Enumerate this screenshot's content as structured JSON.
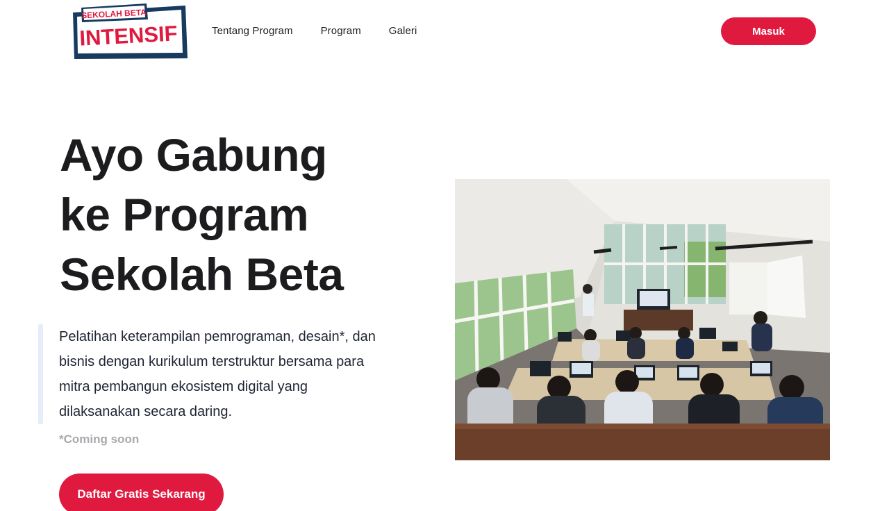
{
  "header": {
    "logo": {
      "top_text": "SEKOLAH BETA",
      "main_text": "INTENSIF"
    },
    "nav": [
      {
        "label": "Tentang Program"
      },
      {
        "label": "Program"
      },
      {
        "label": "Galeri"
      }
    ],
    "login_label": "Masuk"
  },
  "hero": {
    "title_lines": [
      "Ayo Gabung",
      "ke Program",
      "Sekolah Beta"
    ],
    "description": "Pelatihan keterampilan pemrograman, desain*, dan bisnis dengan kurikulum terstruktur bersama para mitra pembangun ekosistem digital yang dilaksanakan secara daring.",
    "note": "*Coming soon",
    "cta_label": "Daftar Gratis Sekarang"
  },
  "colors": {
    "brand_red": "#e0193f",
    "brand_navy": "#173a5e",
    "text_dark": "#1c1c1f",
    "muted": "#a9a9ae"
  }
}
